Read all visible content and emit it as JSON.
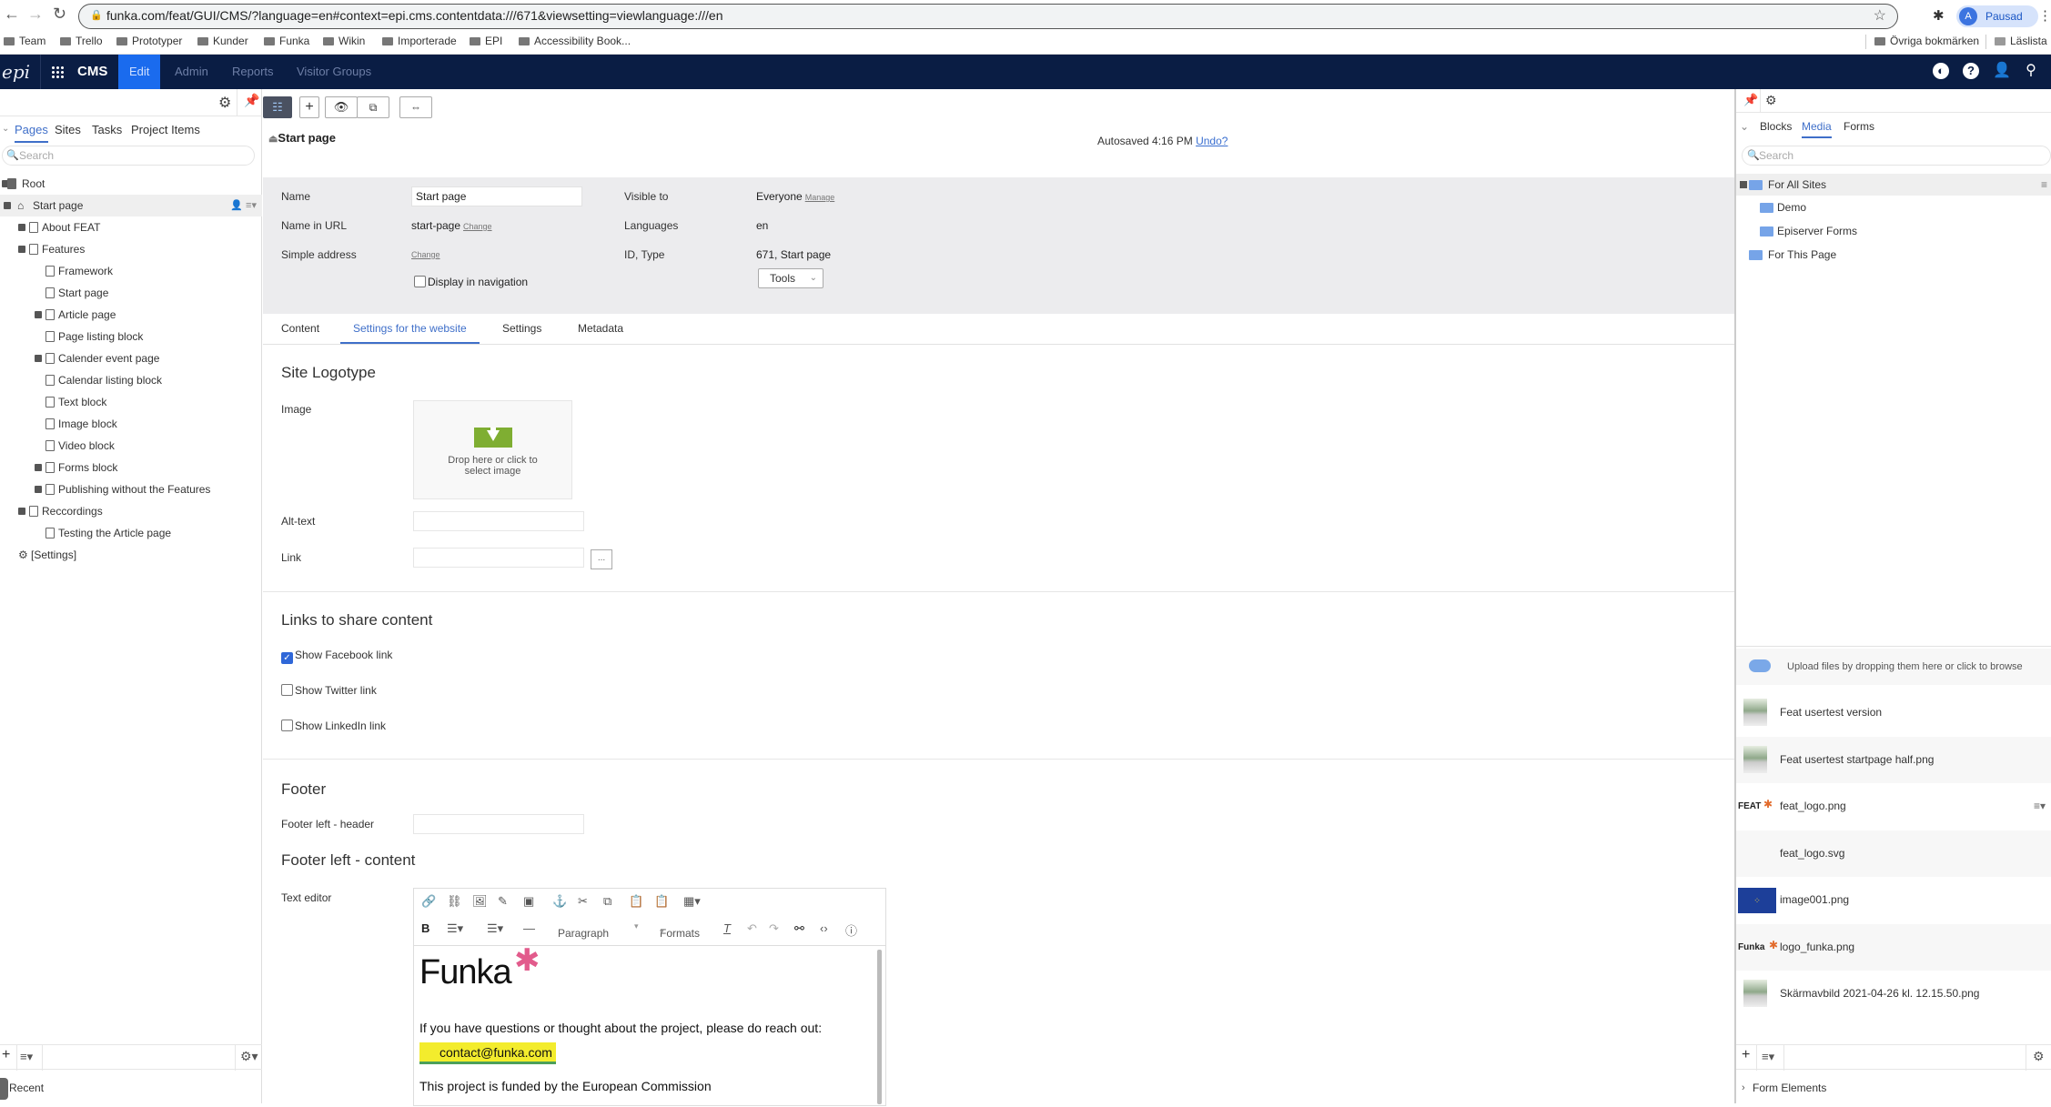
{
  "browser": {
    "url": "funka.com/feat/GUI/CMS/?language=en#context=epi.cms.contentdata:///671&viewsetting=viewlanguage:///en",
    "profile_initial": "A",
    "profile_label": "Pausad",
    "bookmarks": [
      "Team",
      "Trello",
      "Prototyper",
      "Kunder",
      "Funka",
      "Wikin",
      "Importerade",
      "EPI",
      "Accessibility Book..."
    ],
    "other_bookmarks": "Övriga bokmärken",
    "reading_list": "Läslista"
  },
  "cms_nav": {
    "logo": "epi",
    "product": "CMS",
    "tabs": [
      "Edit",
      "Admin",
      "Reports",
      "Visitor Groups"
    ],
    "active_tab": "Edit",
    "accent": "#1a6bee",
    "bar_color": "#0a1d44"
  },
  "left_panel": {
    "tabs": [
      "Pages",
      "Sites",
      "Tasks",
      "Project Items"
    ],
    "active_tab": "Pages",
    "search_placeholder": "Search",
    "tree": [
      {
        "label": "Root",
        "level": 0,
        "expander": true,
        "icon": "root-icon"
      },
      {
        "label": "Start page",
        "level": 1,
        "expander": true,
        "icon": "home-icon",
        "selected": true
      },
      {
        "label": "About FEAT",
        "level": 2,
        "expander": true,
        "icon": "page-icon"
      },
      {
        "label": "Features",
        "level": 2,
        "expander": true,
        "icon": "page-icon"
      },
      {
        "label": "Framework",
        "level": 3,
        "expander": false,
        "icon": "page-icon"
      },
      {
        "label": "Start page",
        "level": 3,
        "expander": false,
        "icon": "page-icon"
      },
      {
        "label": "Article page",
        "level": 3,
        "expander": true,
        "icon": "page-icon"
      },
      {
        "label": "Page listing block",
        "level": 3,
        "expander": false,
        "icon": "page-icon"
      },
      {
        "label": "Calender event page",
        "level": 3,
        "expander": true,
        "icon": "page-icon"
      },
      {
        "label": "Calendar listing block",
        "level": 3,
        "expander": false,
        "icon": "page-icon"
      },
      {
        "label": "Text block",
        "level": 3,
        "expander": false,
        "icon": "page-icon"
      },
      {
        "label": "Image block",
        "level": 3,
        "expander": false,
        "icon": "page-icon"
      },
      {
        "label": "Video block",
        "level": 3,
        "expander": false,
        "icon": "page-icon"
      },
      {
        "label": "Forms block",
        "level": 3,
        "expander": true,
        "icon": "page-icon"
      },
      {
        "label": "Publishing without the Features",
        "level": 3,
        "expander": true,
        "icon": "page-icon"
      },
      {
        "label": "Reccordings",
        "level": 2,
        "expander": true,
        "icon": "page-icon"
      },
      {
        "label": "Testing the Article page",
        "level": 3,
        "expander": false,
        "icon": "page-icon"
      },
      {
        "label": "[Settings]",
        "level": 1,
        "expander": false,
        "icon": "gear-icon"
      }
    ],
    "recent_label": "Recent"
  },
  "page": {
    "title": "Start page",
    "autosave": "Autosaved 4:16 PM",
    "undo": "Undo?",
    "properties": {
      "name_label": "Name",
      "name_value": "Start page",
      "url_label": "Name in URL",
      "url_value": "start-page",
      "change": "Change",
      "simple_label": "Simple address",
      "display_nav": "Display in navigation",
      "display_nav_checked": false,
      "visible_label": "Visible to",
      "visible_value": "Everyone",
      "manage": "Manage",
      "languages_label": "Languages",
      "languages_value": "en",
      "id_label": "ID, Type",
      "id_value": "671, Start page",
      "tools": "Tools"
    },
    "tabs": [
      "Content",
      "Settings for the website",
      "Settings",
      "Metadata"
    ],
    "active_tab": "Settings for the website",
    "sections": {
      "logotype": {
        "heading": "Site Logotype",
        "image_label": "Image",
        "drop_text_1": "Drop here or click to",
        "drop_text_2": "select image",
        "alt_label": "Alt-text",
        "link_label": "Link",
        "link_button": "..."
      },
      "share": {
        "heading": "Links to share content",
        "options": [
          {
            "label": "Show Facebook link",
            "checked": true
          },
          {
            "label": "Show Twitter link",
            "checked": false
          },
          {
            "label": "Show LinkedIn link",
            "checked": false
          }
        ]
      },
      "footer": {
        "heading": "Footer",
        "header_label": "Footer left - header",
        "content_heading": "Footer left - content",
        "editor_label": "Text editor",
        "paragraph_select": "Paragraph",
        "formats_select": "Formats",
        "editor_logo": "Funka",
        "editor_text": "If you have questions or thought about the project, please do reach out:",
        "editor_email": "contact@funka.com",
        "editor_text2": "This project is funded by the European Commission"
      }
    }
  },
  "right_panel": {
    "tabs": [
      "Blocks",
      "Media",
      "Forms"
    ],
    "active_tab": "Media",
    "search_placeholder": "Search",
    "folders": [
      {
        "label": "For All Sites",
        "level": 0,
        "selected": true
      },
      {
        "label": "Demo",
        "level": 1
      },
      {
        "label": "Episerver Forms",
        "level": 1
      },
      {
        "label": "For This Page",
        "level": 0
      }
    ],
    "upload_text": "Upload files by dropping them here or click to browse",
    "media": [
      {
        "name": "Feat usertest version",
        "thumb": "screenshot"
      },
      {
        "name": "Feat usertest startpage half.png",
        "thumb": "screenshot"
      },
      {
        "name": "feat_logo.png",
        "thumb": "feat-logo",
        "thumb_text": "FEAT"
      },
      {
        "name": "feat_logo.svg",
        "thumb": "none"
      },
      {
        "name": "image001.png",
        "thumb": "eu-flag"
      },
      {
        "name": "logo_funka.png",
        "thumb": "funka-logo",
        "thumb_text": "Funka"
      },
      {
        "name": "Skärmavbild 2021-04-26 kl. 12.15.50.png",
        "thumb": "screenshot"
      }
    ],
    "form_elements": "Form Elements"
  }
}
